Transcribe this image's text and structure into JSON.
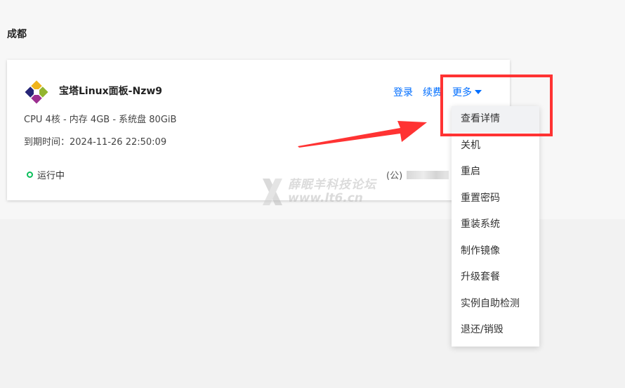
{
  "region": {
    "title": "成都"
  },
  "server": {
    "name": "宝塔Linux面板-Nzw9",
    "spec": "CPU 4核 - 内存 4GB - 系统盘 80GiB",
    "expire_label": "到期时间：",
    "expire_value": "2024-11-26 22:50:09",
    "status": "运行中",
    "ip_prefix": "(公)"
  },
  "actions": {
    "login": "登录",
    "renew": "续费",
    "more": "更多"
  },
  "dropdown": {
    "items": [
      {
        "label": "查看详情"
      },
      {
        "label": "关机"
      },
      {
        "label": "重启"
      },
      {
        "label": "重置密码"
      },
      {
        "label": "重装系统"
      },
      {
        "label": "制作镜像"
      },
      {
        "label": "升级套餐"
      },
      {
        "label": "实例自助检测"
      },
      {
        "label": "退还/销毁"
      }
    ]
  },
  "watermark": {
    "title": "薛眠羊科技论坛",
    "url": "www.lt6.cn"
  },
  "colors": {
    "link": "#006eff",
    "status_running": "#0abf5b",
    "annotation": "#ff3333"
  }
}
